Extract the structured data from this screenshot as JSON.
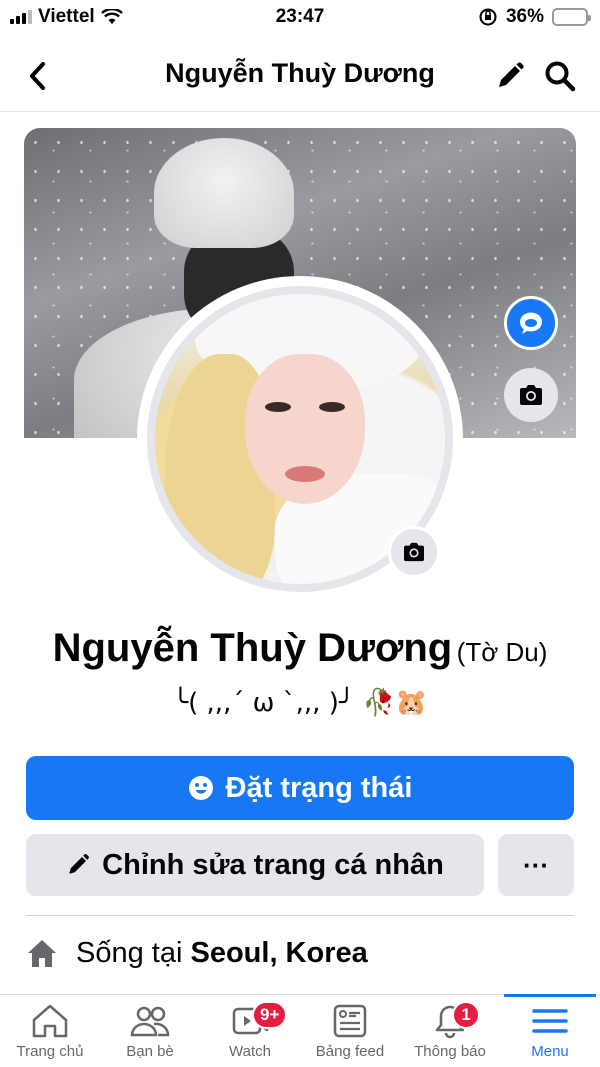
{
  "status_bar": {
    "carrier": "Viettel",
    "time": "23:47",
    "battery": "36%",
    "battery_level": 0.36
  },
  "header": {
    "title": "Nguyễn Thuỳ Dương"
  },
  "profile": {
    "name": "Nguyễn Thuỳ Dương",
    "alternate_name": "(Tờ Du)",
    "bio": "╰(⁠ ⁠,⁠,⁠,⁠´⁠ ⁠ω⁠ ⁠`⁠,⁠,⁠,⁠ ⁠)⁠╯   🥀🐹"
  },
  "actions": {
    "status_button": "Đặt trạng thái",
    "edit_button": "Chỉnh sửa trang cá nhân",
    "more_button": "···"
  },
  "details": {
    "lives_prefix": "Sống tại",
    "lives_place": "Seoul, Korea"
  },
  "nav": {
    "items": [
      {
        "label": "Trang chủ",
        "icon": "home-icon"
      },
      {
        "label": "Bạn bè",
        "icon": "friends-icon"
      },
      {
        "label": "Watch",
        "icon": "watch-icon",
        "badge": "9+"
      },
      {
        "label": "Bảng feed",
        "icon": "feed-icon"
      },
      {
        "label": "Thông báo",
        "icon": "bell-icon",
        "badge": "1"
      },
      {
        "label": "Menu",
        "icon": "menu-icon"
      }
    ]
  },
  "colors": {
    "accent": "#1877f2",
    "badge": "#e41e3f",
    "battery": "#f7c515",
    "button_gray": "#e4e6eb"
  }
}
